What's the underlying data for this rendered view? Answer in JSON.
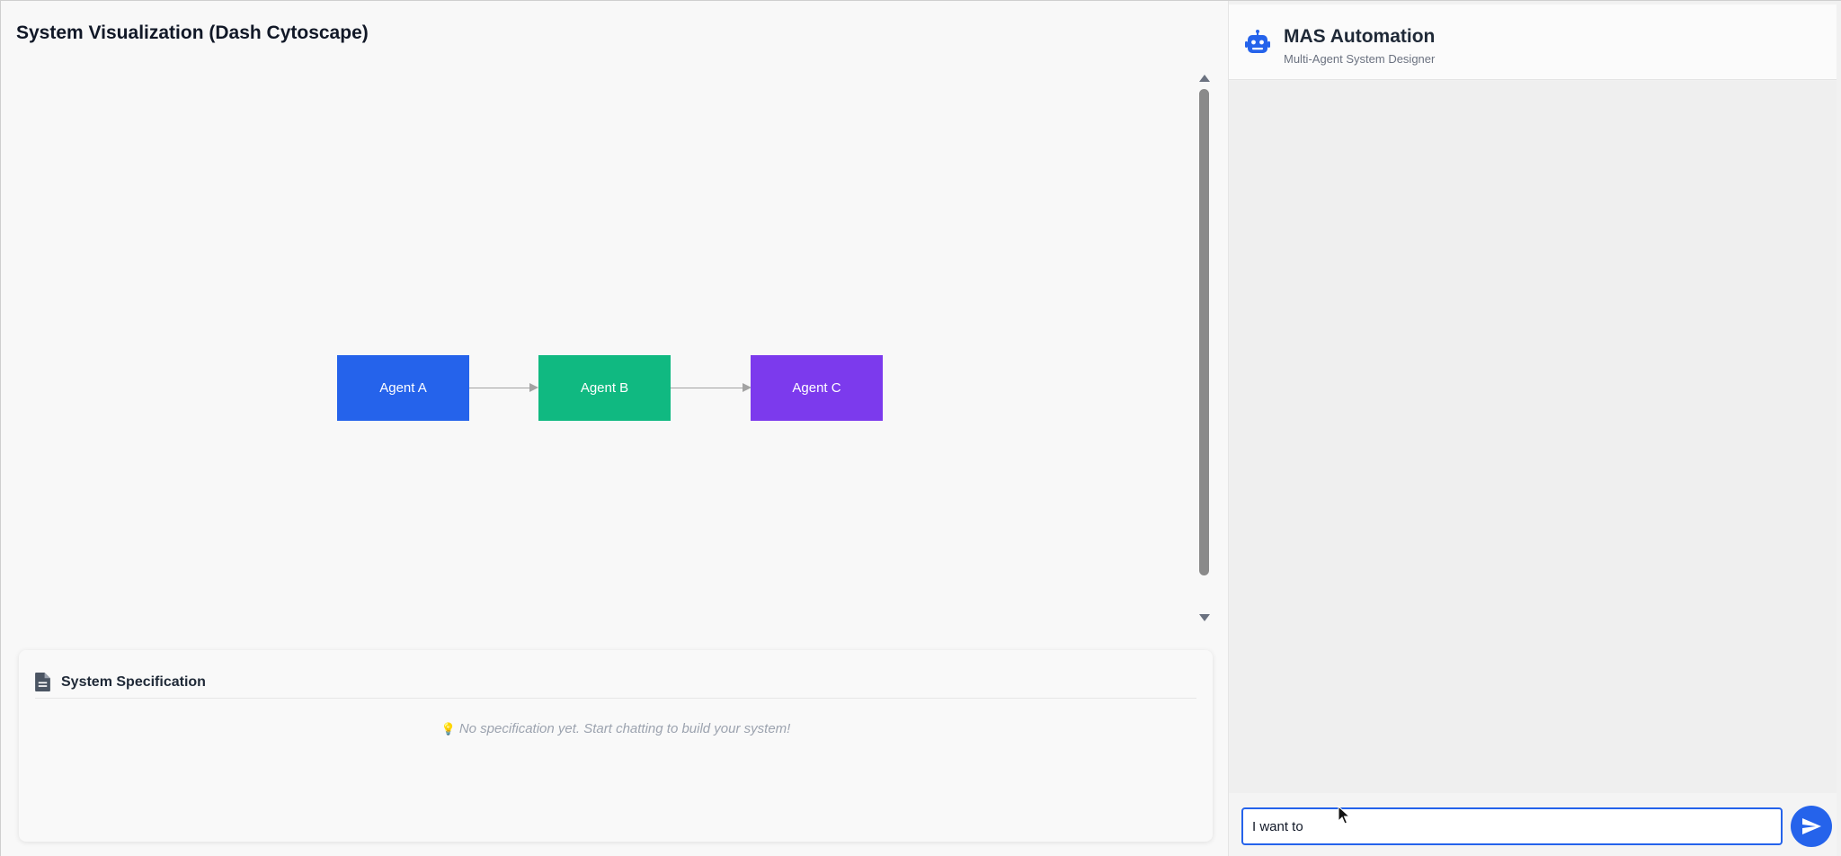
{
  "visualization": {
    "title": "System Visualization (Dash Cytoscape)",
    "nodes": [
      {
        "label": "Agent A",
        "color": "#2563eb"
      },
      {
        "label": "Agent B",
        "color": "#10b981"
      },
      {
        "label": "Agent C",
        "color": "#7c3aed"
      }
    ],
    "edges": [
      {
        "from": "Agent A",
        "to": "Agent B"
      },
      {
        "from": "Agent B",
        "to": "Agent C"
      }
    ]
  },
  "specification": {
    "icon": "document-icon",
    "title": "System Specification",
    "empty_icon": "lightbulb-icon",
    "empty_message": "No specification yet. Start chatting to build your system!"
  },
  "chat": {
    "icon": "robot-icon",
    "title": "MAS Automation",
    "subtitle": "Multi-Agent System Designer",
    "input_value": "I want to ",
    "send_icon": "send-icon",
    "accent": "#2563eb"
  }
}
